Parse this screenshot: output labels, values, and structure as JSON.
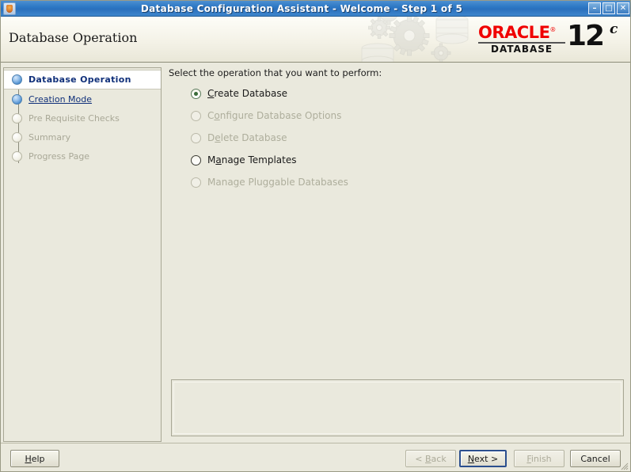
{
  "window": {
    "title": "Database Configuration Assistant - Welcome - Step 1 of 5",
    "app_icon": "java-coffee-cup-icon",
    "controls": {
      "minimize": "–",
      "maximize": "□",
      "close": "✕"
    }
  },
  "header": {
    "title": "Database Operation",
    "brand": {
      "name": "ORACLE",
      "registered": "®",
      "product": "DATABASE",
      "version": "12",
      "edition": "c"
    },
    "decoration": "gears-and-database-cylinders-watermark"
  },
  "sidebar": {
    "items": [
      {
        "label": "Database Operation",
        "state": "current",
        "bullet": "done"
      },
      {
        "label": "Creation Mode",
        "state": "link",
        "bullet": "done"
      },
      {
        "label": "Pre Requisite Checks",
        "state": "disabled",
        "bullet": "todo"
      },
      {
        "label": "Summary",
        "state": "disabled",
        "bullet": "todo"
      },
      {
        "label": "Progress Page",
        "state": "disabled",
        "bullet": "todo"
      }
    ]
  },
  "main": {
    "prompt": "Select the operation that you want to perform:",
    "options": [
      {
        "label": "Create Database",
        "mnemonic": "C",
        "selected": true,
        "enabled": true
      },
      {
        "label": "Configure Database Options",
        "mnemonic": "o",
        "selected": false,
        "enabled": false
      },
      {
        "label": "Delete Database",
        "mnemonic": "e",
        "selected": false,
        "enabled": false
      },
      {
        "label": "Manage Templates",
        "mnemonic": "a",
        "selected": false,
        "enabled": true
      },
      {
        "label": "Manage Pluggable Databases",
        "mnemonic": "g",
        "selected": false,
        "enabled": false
      }
    ]
  },
  "footer": {
    "help": {
      "label": "Help",
      "mnemonic": "H",
      "enabled": true,
      "focused": false
    },
    "back": {
      "label": "< Back",
      "mnemonic": "B",
      "enabled": false,
      "focused": false
    },
    "next": {
      "label": "Next >",
      "mnemonic": "N",
      "enabled": true,
      "focused": true
    },
    "finish": {
      "label": "Finish",
      "mnemonic": "F",
      "enabled": false,
      "focused": false
    },
    "cancel": {
      "label": "Cancel",
      "mnemonic": "",
      "enabled": true,
      "focused": false
    }
  },
  "colors": {
    "window_background": "#eae9dd",
    "titlebar": "#2c77c4",
    "accent_link": "#10307a",
    "oracle_red": "#f00000",
    "selected_radio": "#3a6b3a",
    "focus_border": "#2b4f8e"
  }
}
